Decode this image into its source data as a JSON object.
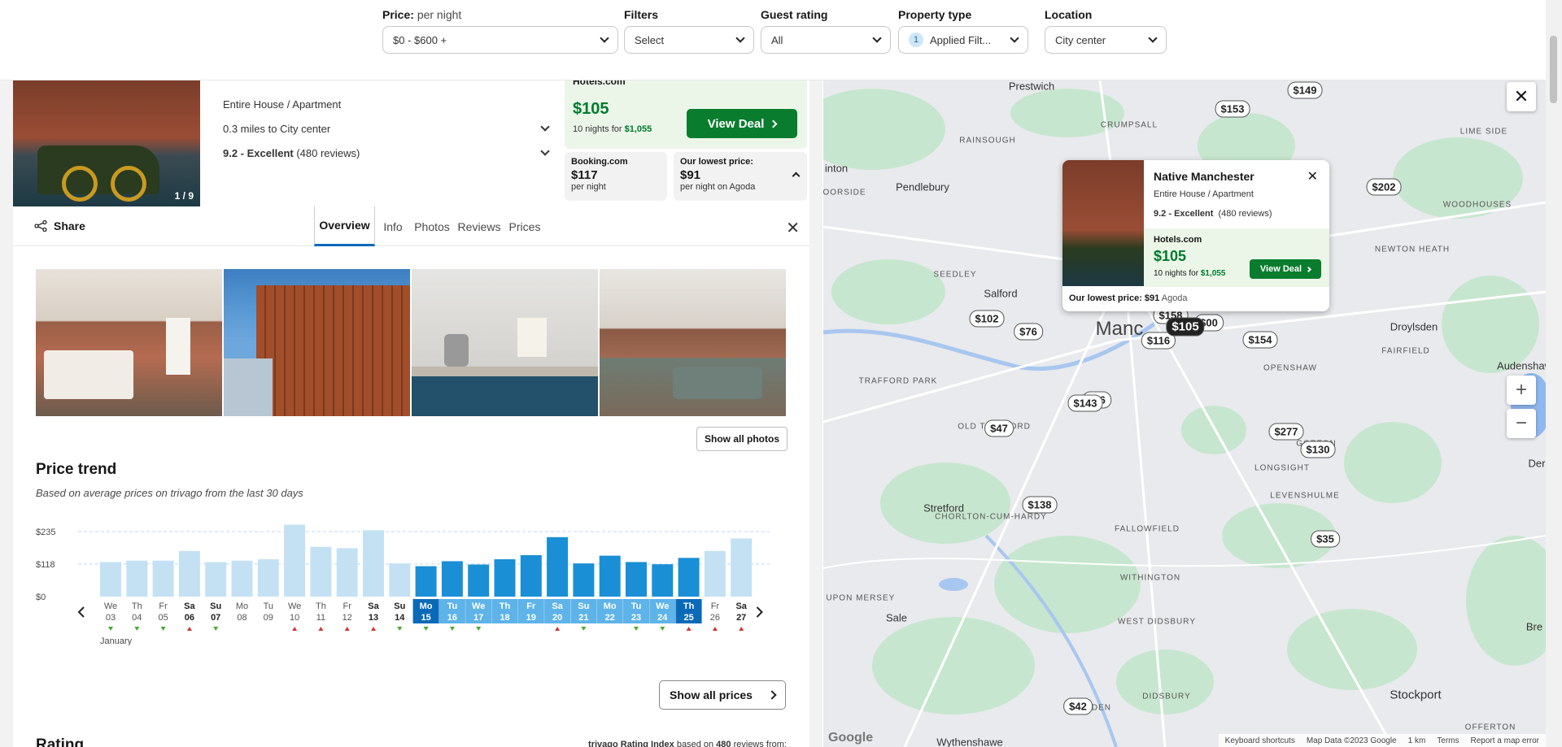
{
  "filters": [
    {
      "label": "Price:",
      "sublabel": "per night",
      "value": "$0 - $600 +"
    },
    {
      "label": "Filters",
      "sublabel": "",
      "value": "Select"
    },
    {
      "label": "Guest rating",
      "sublabel": "",
      "value": "All"
    },
    {
      "label": "Property type",
      "sublabel": "",
      "value": "Applied Filt...",
      "count": "1"
    },
    {
      "label": "Location",
      "sublabel": "",
      "value": "City center"
    }
  ],
  "listing": {
    "type": "Entire House / Apartment",
    "distance": "0.3 miles to City center",
    "rating_score": "9.2 - Excellent",
    "rating_reviews": "(480 reviews)",
    "photo_count": "1 / 9",
    "deal_provider": "Hotels.com",
    "deal_price": "$105",
    "deal_nights_prefix": "10 nights for",
    "deal_total": "$1,055",
    "view_deal": "View Deal",
    "alt1_name": "Booking.com",
    "alt1_price": "$117",
    "alt1_sub": "per night",
    "alt2_name": "Our lowest price:",
    "alt2_price": "$91",
    "alt2_sub": "per night on Agoda"
  },
  "tabs": {
    "share": "Share",
    "items": [
      "Overview",
      "Info",
      "Photos",
      "Reviews",
      "Prices"
    ]
  },
  "photos": {
    "show_all": "Show all photos"
  },
  "price_trend": {
    "title": "Price trend",
    "subtitle": "Based on average prices on trivago from the last 30 days",
    "show_all_prices": "Show all prices",
    "month": "January"
  },
  "chart_data": {
    "type": "bar",
    "yticks": [
      "$235",
      "$118",
      "$0"
    ],
    "ylim": [
      0,
      235
    ],
    "days": [
      "We",
      "Th",
      "Fr",
      "Sa",
      "Su",
      "Mo",
      "Tu",
      "We",
      "Th",
      "Fr",
      "Sa",
      "Su",
      "Mo",
      "Tu",
      "We",
      "Th",
      "Fr",
      "Sa",
      "Su",
      "Mo",
      "Tu",
      "We",
      "Th",
      "Fr",
      "Sa"
    ],
    "dates": [
      "03",
      "04",
      "05",
      "06",
      "07",
      "08",
      "09",
      "10",
      "11",
      "12",
      "13",
      "14",
      "15",
      "16",
      "17",
      "18",
      "19",
      "20",
      "21",
      "22",
      "23",
      "24",
      "25",
      "26",
      "27"
    ],
    "bold": [
      false,
      false,
      false,
      true,
      true,
      false,
      false,
      false,
      false,
      false,
      true,
      true,
      false,
      false,
      false,
      false,
      false,
      true,
      true,
      false,
      false,
      false,
      false,
      false,
      true
    ],
    "values": [
      125,
      130,
      130,
      165,
      125,
      130,
      135,
      260,
      180,
      175,
      240,
      120,
      110,
      128,
      116,
      135,
      150,
      215,
      120,
      148,
      125,
      117,
      140,
      165,
      210
    ],
    "selected": [
      false,
      false,
      false,
      false,
      false,
      false,
      false,
      false,
      false,
      false,
      false,
      false,
      true,
      true,
      true,
      true,
      true,
      true,
      true,
      true,
      true,
      true,
      true,
      false,
      false
    ],
    "range_start": 12,
    "range_end": 22,
    "trend": [
      "down",
      "down",
      "down",
      "up",
      "down",
      "",
      "",
      "up",
      "up",
      "up",
      "up",
      "down",
      "down",
      "down",
      "down",
      "",
      "",
      "up",
      "down",
      "",
      "down",
      "down",
      "up",
      "up",
      "up"
    ]
  },
  "rating": {
    "title": "Rating",
    "index_label": "trivago Rating Index",
    "index_text": "based on",
    "index_count": "480",
    "index_suffix": "reviews from:"
  },
  "map": {
    "popup_name": "Native Manchester",
    "popup_type": "Entire House / Apartment",
    "popup_rating": "9.2 - Excellent",
    "popup_reviews": "(480 reviews)",
    "popup_provider": "Hotels.com",
    "popup_price": "$105",
    "popup_nights_prefix": "10 nights for",
    "popup_total": "$1,055",
    "popup_button": "View Deal",
    "popup_lowest_label": "Our lowest price:",
    "popup_lowest_price": "$91",
    "popup_lowest_site": "Agoda",
    "pins": [
      "$149",
      "$153",
      "$202",
      "$102",
      "$76",
      "$158",
      "$105",
      "$116",
      "$154",
      "$143",
      "$47",
      "$277",
      "$130",
      "$138",
      "$35",
      "$42",
      "$00",
      "$76"
    ],
    "places": [
      "Prestwich",
      "Pendlebury",
      "Salford",
      "Droylsden",
      "Audenshaw",
      "TRAFFORD PARK",
      "OLD TRAFFORD",
      "OPENSHAW",
      "Stretford",
      "LONGSIGHT",
      "GORTON",
      "Sale",
      "FALLOWFIELD",
      "WITHINGTON",
      "WEST DIDSBURY",
      "DIDSBURY",
      "Stockport",
      "Wythenshawe",
      "CRUMPSALL",
      "RAINSOUGH",
      "WOODHOUSES",
      "NEWTON HEATH",
      "LIME SIDE",
      "FAIRFIELD",
      "LEVENSHULME",
      "CHORLTON-CUM-HARDY",
      "Bre",
      "Der",
      "inton",
      "OORSIDE",
      "SEEDLEY",
      "TON UPON MERSEY",
      "OFFERTON",
      "ENDEN",
      "Manc"
    ],
    "footer": [
      "Keyboard shortcuts",
      "Map Data ©2023 Google",
      "1 km",
      "Terms",
      "Report a map error"
    ],
    "google": "Google"
  }
}
